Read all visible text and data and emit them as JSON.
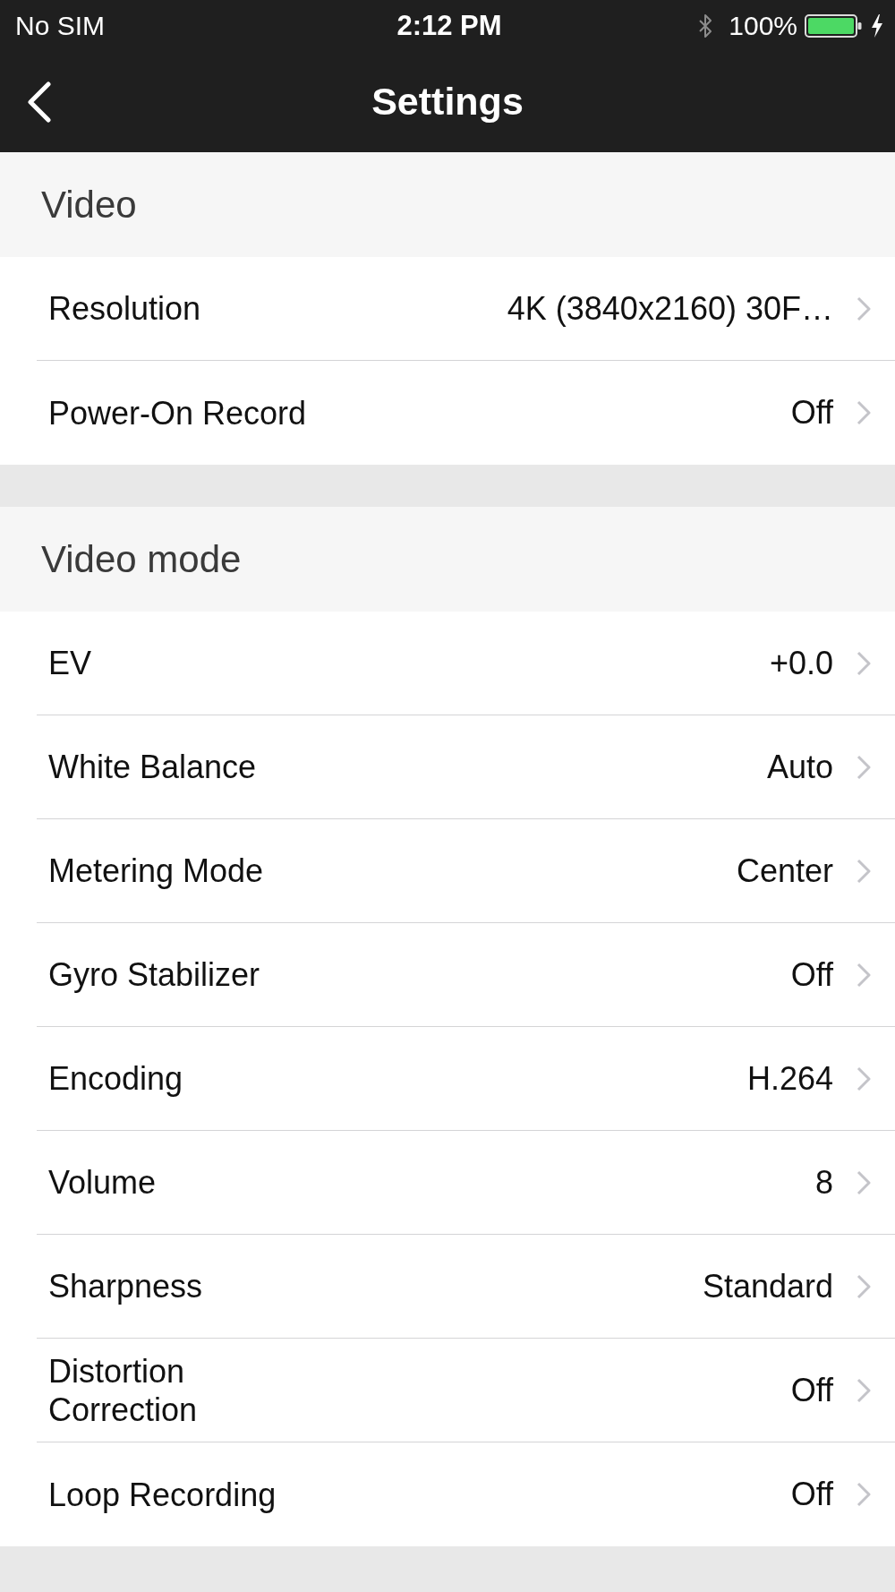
{
  "status_bar": {
    "carrier": "No SIM",
    "time": "2:12 PM",
    "battery": "100%"
  },
  "nav_bar": {
    "title": "Settings"
  },
  "sections": [
    {
      "title": "Video",
      "rows": [
        {
          "label": "Resolution",
          "value": "4K (3840x2160) 30F…"
        },
        {
          "label": "Power-On Record",
          "value": "Off"
        }
      ]
    },
    {
      "title": "Video mode",
      "rows": [
        {
          "label": "EV",
          "value": "+0.0"
        },
        {
          "label": "White Balance",
          "value": "Auto"
        },
        {
          "label": "Metering Mode",
          "value": "Center"
        },
        {
          "label": "Gyro Stabilizer",
          "value": "Off"
        },
        {
          "label": "Encoding",
          "value": "H.264"
        },
        {
          "label": "Volume",
          "value": "8"
        },
        {
          "label": "Sharpness",
          "value": "Standard"
        },
        {
          "label": "Distortion Correction",
          "value": "Off"
        },
        {
          "label": "Loop Recording",
          "value": "Off"
        }
      ]
    }
  ]
}
